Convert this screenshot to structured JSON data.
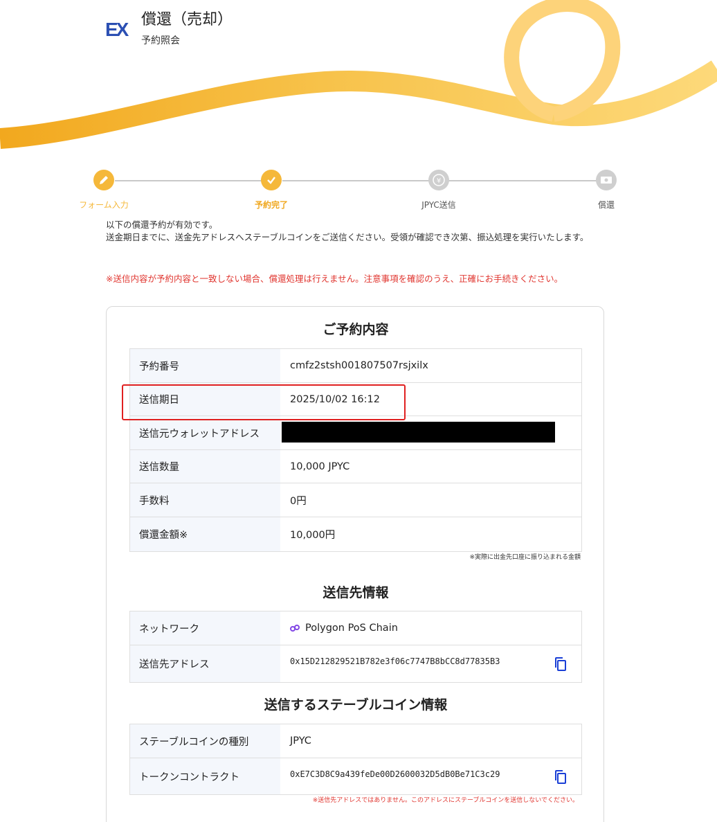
{
  "header": {
    "logo": "EX",
    "title": "償還（売却）",
    "subtitle": "予約照会"
  },
  "stepper": {
    "steps": [
      {
        "label": "フォーム入力",
        "icon": "pencil-icon",
        "state": "done"
      },
      {
        "label": "予約完了",
        "icon": "check-icon",
        "state": "current"
      },
      {
        "label": "JPYC送信",
        "icon": "yen-coin-icon",
        "state": "pending"
      },
      {
        "label": "償還",
        "icon": "cash-icon",
        "state": "pending"
      }
    ]
  },
  "intro": {
    "line1": "以下の償還予約が有効です。",
    "line2": "送金期日までに、送金先アドレスへステーブルコインをご送信ください。受領が確認でき次第、振込処理を実行いたします。",
    "warning": "※送信内容が予約内容と一致しない場合、償還処理は行えません。注意事項を確認のうえ、正確にお手続きください。"
  },
  "reservation": {
    "title": "ご予約内容",
    "rows": [
      {
        "label": "予約番号",
        "value": "cmfz2stsh001807507rsjxilx"
      },
      {
        "label": "送信期日",
        "value": "2025/10/02 16:12"
      },
      {
        "label": "送信元ウォレットアドレス",
        "value": ""
      },
      {
        "label": "送信数量",
        "value": "10,000 JPYC"
      },
      {
        "label": "手数料",
        "value": "0円"
      },
      {
        "label": "償還金額※",
        "value": "10,000円"
      }
    ],
    "note": "※実際に出金先口座に振り込まれる金額"
  },
  "destination": {
    "title": "送信先情報",
    "network_label": "ネットワーク",
    "network_value": "Polygon PoS Chain",
    "address_label": "送信先アドレス",
    "address_value": "0x15D212829521B782e3f06c7747B8bCC8d77835B3"
  },
  "stablecoin": {
    "title": "送信するステーブルコイン情報",
    "type_label": "ステーブルコインの種別",
    "type_value": "JPYC",
    "contract_label": "トークンコントラクト",
    "contract_value": "0xE7C3D8C9a439feDe00D2600032D5dB0Be71C3c29",
    "note": "※送信先アドレスではありません。このアドレスにステーブルコインを送信しないでください。"
  },
  "colors": {
    "accent": "#f5b83a",
    "brand_blue": "#2b4fb3",
    "warning_red": "#e0342e",
    "copy_blue": "#1a3fd6",
    "polygon_purple": "#8247e5"
  }
}
